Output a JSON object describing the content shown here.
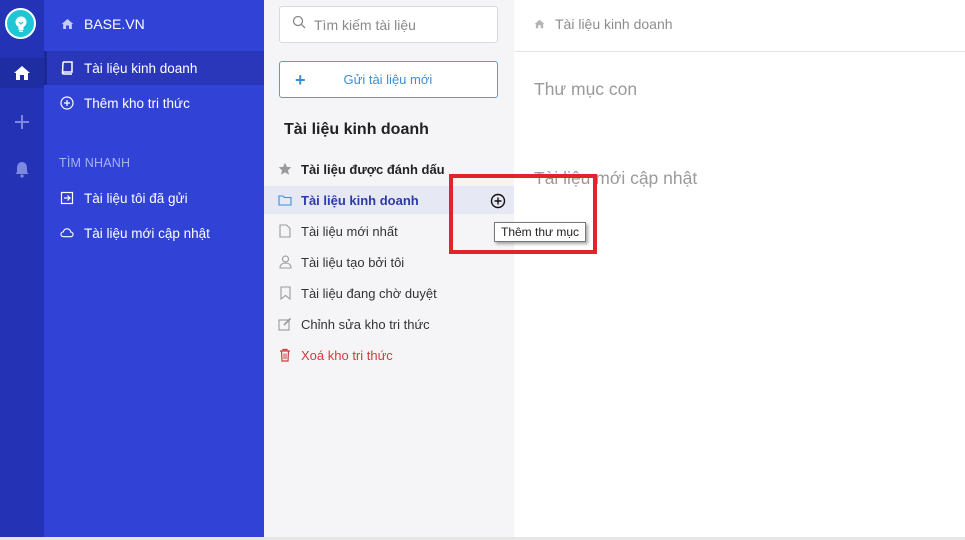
{
  "rail": {
    "logo_icon": "lightbulb-icon",
    "items": [
      {
        "icon": "home-icon",
        "active": true
      },
      {
        "icon": "plus-icon",
        "active": false
      },
      {
        "icon": "bell-icon",
        "active": false
      }
    ]
  },
  "sidebar": {
    "brand": "BASE.VN",
    "items": [
      {
        "label": "Tài liệu kinh doanh",
        "icon": "book-icon"
      },
      {
        "label": "Thêm kho tri thức",
        "icon": "plus-circle-icon"
      }
    ],
    "quick_section": "TÌM NHANH",
    "quick_items": [
      {
        "label": "Tài liệu tôi đã gửi",
        "icon": "sent-icon"
      },
      {
        "label": "Tài liệu mới cập nhật",
        "icon": "cloud-icon"
      }
    ]
  },
  "panel": {
    "search_placeholder": "Tìm kiếm tài liệu",
    "send_label": "Gửi tài liệu mới",
    "title": "Tài liệu kinh doanh",
    "items": [
      {
        "label": "Tài liệu được đánh dấu",
        "icon": "star-icon"
      },
      {
        "label": "Tài liệu kinh doanh",
        "icon": "folder-icon"
      },
      {
        "label": "Tài liệu mới nhất",
        "icon": "file-icon"
      },
      {
        "label": "Tài liệu tạo bởi tôi",
        "icon": "user-icon"
      },
      {
        "label": "Tài liệu đang chờ duyệt",
        "icon": "bookmark-icon"
      },
      {
        "label": "Chỉnh sửa kho tri thức",
        "icon": "edit-icon"
      },
      {
        "label": "Xoá kho tri thức",
        "icon": "trash-icon"
      }
    ],
    "tooltip": "Thêm thư mục"
  },
  "main": {
    "breadcrumb": "Tài liệu kinh doanh",
    "sub_folders": "Thư mục con",
    "recent": "Tài liệu mới cập nhật"
  },
  "colors": {
    "rail": "#2433b5",
    "sidebar": "#3142d6",
    "accent": "#3a8fd6",
    "danger": "#d33b3b",
    "highlight": "#e0242a"
  }
}
